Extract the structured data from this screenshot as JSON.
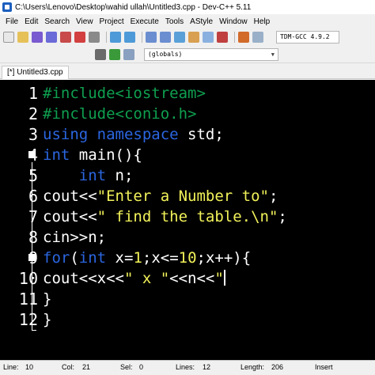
{
  "window": {
    "title": "C:\\Users\\Lenovo\\Desktop\\wahid ullah\\Untitled3.cpp - Dev-C++ 5.11"
  },
  "menu": [
    "File",
    "Edit",
    "Search",
    "View",
    "Project",
    "Execute",
    "Tools",
    "AStyle",
    "Window",
    "Help"
  ],
  "toolbar": {
    "compiler": "TDM-GCC 4.9.2",
    "scope": "(globals)"
  },
  "tab": {
    "label": "[*] Untitled3.cpp"
  },
  "editor": {
    "line_numbers": [
      "1",
      "2",
      "3",
      "4",
      "5",
      "6",
      "7",
      "8",
      "9",
      "10",
      "11",
      "12"
    ],
    "colors": {
      "background": "#000000",
      "preprocessor": "#0f9f4f",
      "keyword": "#2b66e0",
      "string": "#f2f25a",
      "text": "#ffffff"
    },
    "lines": [
      [
        {
          "t": "pp",
          "v": "#include<iostream>"
        }
      ],
      [
        {
          "t": "pp",
          "v": "#include<conio.h>"
        }
      ],
      [
        {
          "t": "kw",
          "v": "using namespace"
        },
        {
          "t": "sym",
          "v": " std;"
        }
      ],
      [
        {
          "t": "kw",
          "v": "int"
        },
        {
          "t": "sym",
          "v": " main(){"
        }
      ],
      [
        {
          "t": "sym",
          "v": "    "
        },
        {
          "t": "kw",
          "v": "int"
        },
        {
          "t": "sym",
          "v": " n;"
        }
      ],
      [
        {
          "t": "sym",
          "v": "cout<<"
        },
        {
          "t": "str",
          "v": "\"Enter a Number to\""
        },
        {
          "t": "sym",
          "v": ";"
        }
      ],
      [
        {
          "t": "sym",
          "v": "cout<<"
        },
        {
          "t": "str",
          "v": "\" find the table.\\n\""
        },
        {
          "t": "sym",
          "v": ";"
        }
      ],
      [
        {
          "t": "sym",
          "v": "cin>>n;"
        }
      ],
      [
        {
          "t": "kw",
          "v": "for"
        },
        {
          "t": "sym",
          "v": "("
        },
        {
          "t": "kw",
          "v": "int"
        },
        {
          "t": "sym",
          "v": " x="
        },
        {
          "t": "num",
          "v": "1"
        },
        {
          "t": "sym",
          "v": ";x<="
        },
        {
          "t": "num",
          "v": "10"
        },
        {
          "t": "sym",
          "v": ";x++){"
        }
      ],
      [
        {
          "t": "sym",
          "v": "cout<<x<<"
        },
        {
          "t": "str",
          "v": "\" x \""
        },
        {
          "t": "sym",
          "v": "<<n<<"
        },
        {
          "t": "str",
          "v": "\""
        }
      ],
      [
        {
          "t": "sym",
          "v": "}"
        }
      ],
      [
        {
          "t": "sym",
          "v": "}"
        }
      ]
    ]
  },
  "status": {
    "line_label": "Line:",
    "line_value": "10",
    "col_label": "Col:",
    "col_value": "21",
    "sel_label": "Sel:",
    "sel_value": "0",
    "lines_label": "Lines:",
    "lines_value": "12",
    "length_label": "Length:",
    "length_value": "206",
    "mode": "Insert"
  }
}
